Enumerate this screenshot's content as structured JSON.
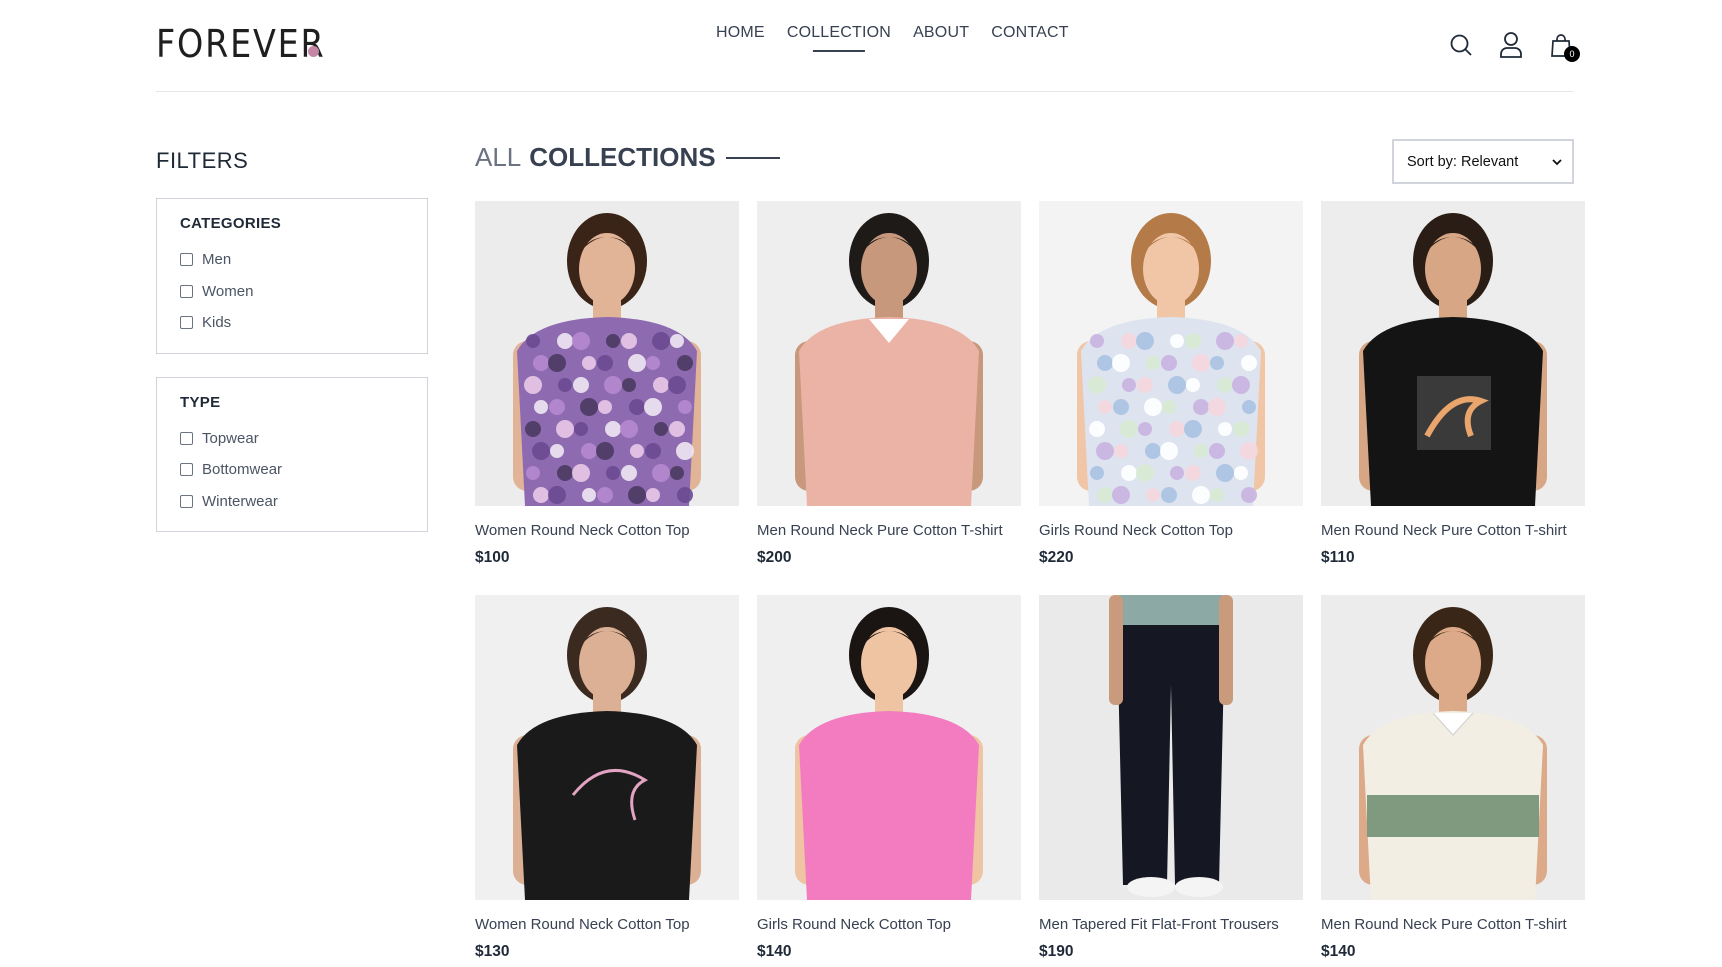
{
  "brand": {
    "logo_text": "FOREVER",
    "dot_color": "#c586a5"
  },
  "nav": {
    "items": [
      "HOME",
      "COLLECTION",
      "ABOUT",
      "CONTACT"
    ],
    "active": "COLLECTION"
  },
  "header": {
    "cart_count": "0"
  },
  "filters": {
    "title": "FILTERS",
    "categories": {
      "title": "CATEGORIES",
      "options": [
        "Men",
        "Women",
        "Kids"
      ]
    },
    "type": {
      "title": "TYPE",
      "options": [
        "Topwear",
        "Bottomwear",
        "Winterwear"
      ]
    }
  },
  "collection": {
    "title_light": "ALL",
    "title_dark": "COLLECTIONS",
    "sort_label": "Sort by: Relevant"
  },
  "products": [
    {
      "name": "Women Round Neck Cotton Top",
      "price": "$100",
      "bg": "#ececec",
      "garment": "#8e6ab0",
      "pattern": "floral",
      "skin": "#e2b497",
      "hair": "#3a2418"
    },
    {
      "name": "Men Round Neck Pure Cotton T-shirt",
      "price": "$200",
      "bg": "#eeeeee",
      "garment": "#eab3a6",
      "pattern": "solid",
      "skin": "#c8987c",
      "hair": "#1e1a18"
    },
    {
      "name": "Girls Round Neck Cotton Top",
      "price": "$220",
      "bg": "#f3f3f3",
      "garment": "#dde4f0",
      "pattern": "floral-light",
      "skin": "#f0c6a6",
      "hair": "#b47a48"
    },
    {
      "name": "Men Round Neck Pure Cotton T-shirt",
      "price": "$110",
      "bg": "#ededed",
      "garment": "#141414",
      "pattern": "print",
      "skin": "#d7a785",
      "hair": "#2a1d16"
    },
    {
      "name": "Women Round Neck Cotton Top",
      "price": "$130",
      "bg": "#f0f0f0",
      "garment": "#1a1a1a",
      "pattern": "print-outline",
      "skin": "#dcb094",
      "hair": "#3b2a20"
    },
    {
      "name": "Girls Round Neck Cotton Top",
      "price": "$140",
      "bg": "#efefef",
      "garment": "#f37cc0",
      "pattern": "solid",
      "skin": "#efc4a2",
      "hair": "#1a1412"
    },
    {
      "name": "Men Tapered Fit Flat-Front Trousers",
      "price": "$190",
      "bg": "#eaeaea",
      "garment": "#151722",
      "pattern": "trousers",
      "skin": "#c99b7c",
      "hair": "#8da9a6"
    },
    {
      "name": "Men Round Neck Pure Cotton T-shirt",
      "price": "$140",
      "bg": "#ececec",
      "garment": "#f2eee3",
      "pattern": "stripe",
      "skin": "#dcaa88",
      "hair": "#3a2616"
    }
  ]
}
